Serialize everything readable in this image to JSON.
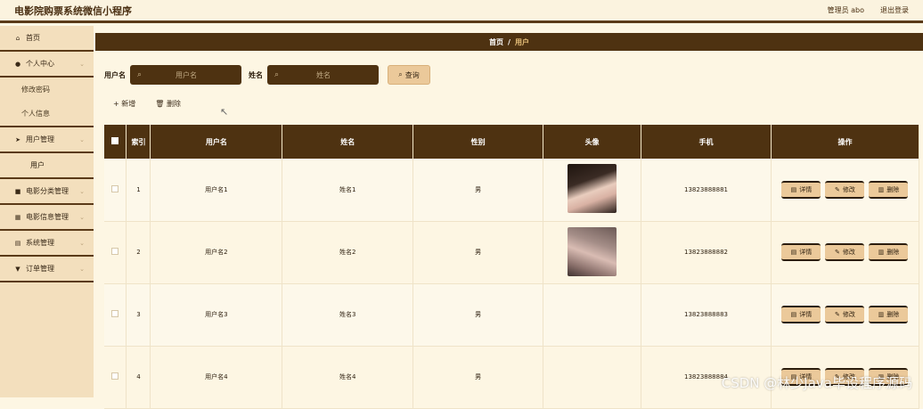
{
  "app": {
    "title": "电影院购票系统微信小程序"
  },
  "topbar": {
    "user": "管理员 abo",
    "logout": "退出登录"
  },
  "sidebar": {
    "items": [
      {
        "label": "首页",
        "icon": "home-icon",
        "glyph": "⌂"
      },
      {
        "label": "个人中心",
        "icon": "user-icon",
        "glyph": "●"
      },
      {
        "label": "用户管理",
        "icon": "send-icon",
        "glyph": "➤"
      },
      {
        "label": "电影分类管理",
        "icon": "box-icon",
        "glyph": "■"
      },
      {
        "label": "电影信息管理",
        "icon": "grid-icon",
        "glyph": "▦"
      },
      {
        "label": "系统管理",
        "icon": "chart-icon",
        "glyph": "▤"
      },
      {
        "label": "订单管理",
        "icon": "pin-icon",
        "glyph": "▼"
      }
    ],
    "sub_personal": [
      "修改密码",
      "个人信息"
    ],
    "sub_user": [
      "用户"
    ]
  },
  "breadcrumb": {
    "home": "首页",
    "sep": "/",
    "current": "用户"
  },
  "search": {
    "username_label": "用户名",
    "username_placeholder": "用户名",
    "name_label": "姓名",
    "name_placeholder": "姓名",
    "query_label": "查询"
  },
  "actions": {
    "add": "+ 新增",
    "delete": "🗑 删除"
  },
  "table": {
    "headers": [
      "索引",
      "用户名",
      "姓名",
      "性别",
      "头像",
      "手机",
      "操作"
    ],
    "rows": [
      {
        "index": "1",
        "username": "用户名1",
        "name": "姓名1",
        "gender": "男",
        "phone": "13823888881",
        "avatar": "av1"
      },
      {
        "index": "2",
        "username": "用户名2",
        "name": "姓名2",
        "gender": "男",
        "phone": "13823888882",
        "avatar": "av2"
      },
      {
        "index": "3",
        "username": "用户名3",
        "name": "姓名3",
        "gender": "男",
        "phone": "13823888883",
        "avatar": ""
      },
      {
        "index": "4",
        "username": "用户名4",
        "name": "姓名4",
        "gender": "男",
        "phone": "13823888884",
        "avatar": ""
      }
    ],
    "ops": {
      "detail": "详情",
      "edit": "修改",
      "delete": "删除"
    }
  },
  "watermark": "CSDN @林少Java毕设程序源码",
  "colors": {
    "primary": "#4e3211",
    "accent": "#ebc99a",
    "sidebar": "#f3dfbd",
    "background": "#fdf6e3"
  }
}
